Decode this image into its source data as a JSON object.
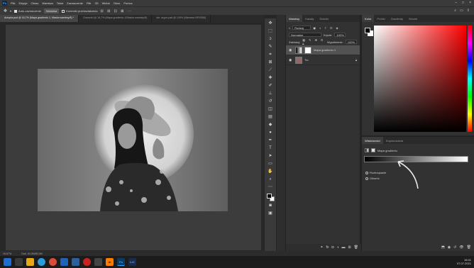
{
  "menubar": {
    "logo": "Ps",
    "items": [
      "Plik",
      "Edycja",
      "Obraz",
      "Warstwa",
      "Tekst",
      "Zaznaczenie",
      "Filtr",
      "3D",
      "Widok",
      "Okno",
      "Pomoc"
    ],
    "window_controls": [
      "–",
      "□",
      "×"
    ]
  },
  "options_bar": {
    "auto_select_label": "Auto-zaznaczenie",
    "auto_select_target": "Warstwa",
    "transform_controls_label": "Kontrolki przekształcenia",
    "right_icons": [
      "search-icon",
      "workspace-icon",
      "share-icon"
    ]
  },
  "doc_tabs": [
    {
      "title": "Autopia.psd @ 16,7% (Mapa gradientu 1, Maska warstwy/8) *",
      "active": true
    },
    {
      "title": "Grawerki @ 16,7% (Mapa gradientu 1/Maska warstwy/8)",
      "active": false
    },
    {
      "title": "obr. argon.psd @ 100% (Warstwa 0/RGB/8)",
      "active": false
    }
  ],
  "tools": [
    "move-tool",
    "marquee-tool",
    "lasso-tool",
    "quick-select-tool",
    "crop-tool",
    "frame-tool",
    "eyedropper-tool",
    "healing-tool",
    "brush-tool",
    "clone-stamp-tool",
    "history-brush-tool",
    "eraser-tool",
    "gradient-tool",
    "blur-tool",
    "dodge-tool",
    "pen-tool",
    "type-tool",
    "path-select-tool",
    "rectangle-tool",
    "hand-tool",
    "zoom-tool",
    "more-tools"
  ],
  "layers_panel": {
    "tabs": [
      "Warstwy",
      "Kanały",
      "Ścieżki"
    ],
    "active_tab": "Warstwy",
    "filter_label": "Rodzaj",
    "blend_mode": "Normalne",
    "opacity_label": "Krycie:",
    "opacity_value": "100%",
    "lock_label": "Zablokuj:",
    "fill_label": "Wypełnienie:",
    "fill_value": "100%",
    "layers": [
      {
        "name": "Mapa gradientu 1",
        "selected": true
      },
      {
        "name": "Tło",
        "selected": false
      }
    ]
  },
  "color_panel": {
    "tabs": [
      "Kolor",
      "Próbki",
      "Gradienty",
      "Wzorki"
    ],
    "active_tab": "Kolor"
  },
  "properties_panel": {
    "tabs": [
      "Właściwości",
      "Dopasowania"
    ],
    "active_tab": "Właściwości",
    "header": "Mapa gradientu",
    "options": [
      "Roztrząsanie",
      "Odwróć"
    ]
  },
  "status_bar": {
    "zoom": "16,67%",
    "doc_info": "Dok: 40,0M/80,0M"
  },
  "taskbar": {
    "apps": [
      {
        "name": "start",
        "label": "",
        "color": "#1f6fd1"
      },
      {
        "name": "search",
        "label": "",
        "color": "#3a3a3a"
      },
      {
        "name": "files",
        "label": "",
        "color": "#e6a817"
      },
      {
        "name": "edge",
        "label": "",
        "color": "#2b9bd9"
      },
      {
        "name": "chrome",
        "label": "",
        "color": "#d94c3a"
      },
      {
        "name": "mail",
        "label": "",
        "color": "#1d63b8"
      },
      {
        "name": "explorer",
        "label": "",
        "color": "#2b5f9e"
      },
      {
        "name": "opera",
        "label": "",
        "color": "#c8231f"
      },
      {
        "name": "store",
        "label": "",
        "color": "#444"
      },
      {
        "name": "illustrator",
        "label": "Ai",
        "color": "#ff7c00"
      },
      {
        "name": "photoshop",
        "label": "Ps",
        "color": "#0a3a66"
      },
      {
        "name": "lightroom",
        "label": "LrC",
        "color": "#1a2c4a"
      }
    ],
    "clock_time": "16:41",
    "clock_date": "07.07.2021",
    "lang": "POL"
  },
  "colors": {
    "accent": "#31a8ff",
    "panel": "#323232",
    "selection": "#525252"
  }
}
